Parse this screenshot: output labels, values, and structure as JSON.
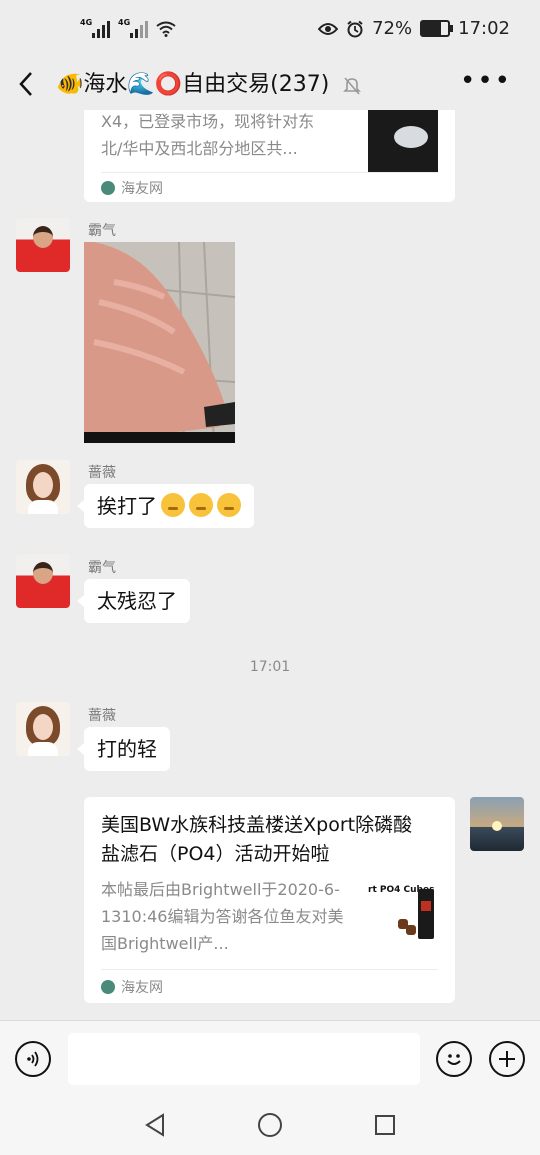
{
  "status_bar": {
    "network_1": "4G",
    "network_2": "4G",
    "battery": "72%",
    "battery_level": 0.72,
    "time": "17:02",
    "icons": [
      "eye-icon",
      "alarm-icon",
      "battery-icon"
    ]
  },
  "header": {
    "title": "🐠海水🌊⭕自由交易(237)",
    "icons": [
      "back-icon",
      "mute-bell-icon",
      "more-icon"
    ]
  },
  "messages": {
    "card1": {
      "desc_line1": "X4，已登录市场，现将针对东",
      "desc_line2": "北/华中及西北部分地区共...",
      "source": "海友网"
    },
    "m1": {
      "sender": "霸气"
    },
    "m2": {
      "sender": "蔷薇",
      "text": "挨打了"
    },
    "m3": {
      "sender": "霸气",
      "text": "太残忍了"
    },
    "timestamp": "17:01",
    "m4": {
      "sender": "蔷薇",
      "text": "打的轻"
    },
    "card2": {
      "title": "美国BW水族科技盖楼送Xport除磷酸盐滤石（PO4）活动开始啦",
      "desc": "本帖最后由Brightwell于2020-6-1310:46编辑为答谢各位鱼友对美国Brightwell产...",
      "thumb_label": "rt PO4 Cubes",
      "source": "海友网"
    }
  },
  "input_bar": {
    "icons": [
      "voice-icon",
      "emoji-icon",
      "plus-icon"
    ]
  },
  "system_nav": {
    "icons": [
      "back-triangle-icon",
      "home-circle-icon",
      "recents-square-icon"
    ]
  },
  "colors": {
    "background": "#ededed",
    "bubble": "#ffffff",
    "meta_text": "#8a8a8a"
  }
}
